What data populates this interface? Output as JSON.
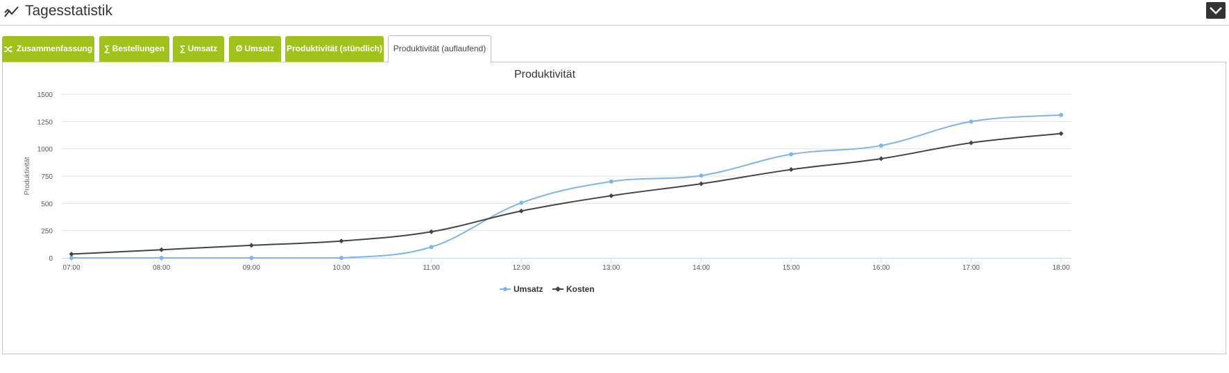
{
  "header": {
    "title": "Tagesstatistik",
    "icon": "line-chart-icon",
    "collapse_icon": "chevron-down-icon"
  },
  "tabs": [
    {
      "label": "Zusammenfassung",
      "icon": "shuffle-icon",
      "active": false
    },
    {
      "label": "∑ Bestellungen",
      "active": false
    },
    {
      "label": "∑ Umsatz",
      "active": false
    },
    {
      "label": "Ø Umsatz",
      "active": false
    },
    {
      "label": "Produktivität (stündlich)",
      "active": false
    },
    {
      "label": "Produktivität (auflaufend)",
      "active": true
    }
  ],
  "colors": {
    "tab_green": "#a1c21a",
    "umsatz": "#7cb5ec",
    "kosten": "#434348"
  },
  "chart_data": {
    "type": "line",
    "title": "Produktivität",
    "xlabel": "",
    "ylabel": "Produktivität",
    "categories": [
      "07:00",
      "08:00",
      "09:00",
      "10:00",
      "11:00",
      "12:00",
      "13:00",
      "14:00",
      "15:00",
      "16:00",
      "17:00",
      "18:00"
    ],
    "yticks": [
      0,
      250,
      500,
      750,
      1000,
      1250,
      1500
    ],
    "ylim": [
      0,
      1500
    ],
    "grid": true,
    "legend_position": "bottom",
    "series": [
      {
        "name": "Umsatz",
        "color": "#7cb5ec",
        "marker": "circle",
        "values": [
          0,
          0,
          0,
          0,
          100,
          505,
          700,
          755,
          950,
          1030,
          1250,
          1310
        ]
      },
      {
        "name": "Kosten",
        "color": "#434348",
        "marker": "diamond",
        "values": [
          35,
          75,
          115,
          155,
          240,
          430,
          570,
          680,
          810,
          910,
          1055,
          1140
        ]
      }
    ]
  }
}
